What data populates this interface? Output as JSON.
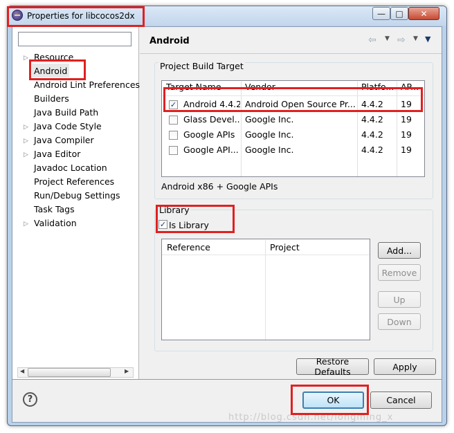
{
  "window": {
    "title": "Properties for libcocos2dx",
    "minimize_glyph": "—",
    "maximize_glyph": "□",
    "close_glyph": "✕"
  },
  "sidebar": {
    "filter_value": "",
    "items": [
      {
        "label": "Resource",
        "expandable": true
      },
      {
        "label": "Android",
        "expandable": false,
        "selected": true
      },
      {
        "label": "Android Lint Preferences",
        "expandable": false
      },
      {
        "label": "Builders",
        "expandable": false
      },
      {
        "label": "Java Build Path",
        "expandable": false
      },
      {
        "label": "Java Code Style",
        "expandable": true
      },
      {
        "label": "Java Compiler",
        "expandable": true
      },
      {
        "label": "Java Editor",
        "expandable": true
      },
      {
        "label": "Javadoc Location",
        "expandable": false
      },
      {
        "label": "Project References",
        "expandable": false
      },
      {
        "label": "Run/Debug Settings",
        "expandable": false
      },
      {
        "label": "Task Tags",
        "expandable": false
      },
      {
        "label": "Validation",
        "expandable": true
      }
    ]
  },
  "page": {
    "title": "Android",
    "icons": {
      "back": "back-arrow-icon",
      "forward": "forward-arrow-icon",
      "menu": "view-menu-icon"
    }
  },
  "build_target": {
    "group_label": "Project Build Target",
    "columns": [
      "Target Name",
      "Vendor",
      "Platfo...",
      "AP..."
    ],
    "rows": [
      {
        "checked": true,
        "name": "Android 4.4.2",
        "vendor": "Android Open Source Pr...",
        "platform": "4.4.2",
        "api": "19"
      },
      {
        "checked": false,
        "name": "Glass Devel...",
        "vendor": "Google Inc.",
        "platform": "4.4.2",
        "api": "19"
      },
      {
        "checked": false,
        "name": "Google APIs",
        "vendor": "Google Inc.",
        "platform": "4.4.2",
        "api": "19"
      },
      {
        "checked": false,
        "name": "Google API...",
        "vendor": "Google Inc.",
        "platform": "4.4.2",
        "api": "19"
      }
    ],
    "description": "Android x86 + Google APIs"
  },
  "library": {
    "group_label": "Library",
    "is_library_label": "Is Library",
    "is_library": true,
    "columns": [
      "Reference",
      "Project"
    ],
    "buttons": {
      "add": "Add...",
      "remove": "Remove",
      "up": "Up",
      "down": "Down"
    }
  },
  "footer": {
    "restore_defaults": "Restore Defaults",
    "apply": "Apply",
    "ok": "OK",
    "cancel": "Cancel",
    "help_glyph": "?"
  },
  "watermark": "http://blog.csdn.net/longming_x",
  "colors": {
    "highlight": "#e02020",
    "titlebar": "#c3d6ec",
    "ok_border": "#3c7fb1"
  }
}
